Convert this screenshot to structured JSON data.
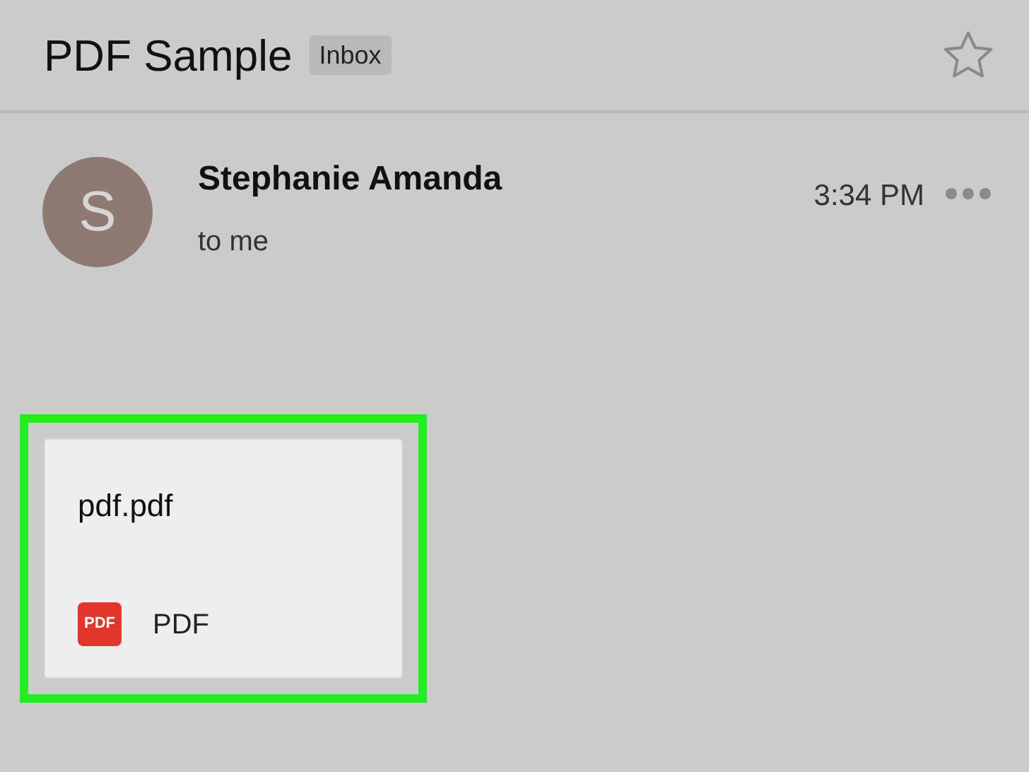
{
  "header": {
    "title": "PDF Sample",
    "label": "Inbox",
    "starred": false
  },
  "message": {
    "avatar_letter": "S",
    "sender": "Stephanie Amanda",
    "recipient": "to me",
    "time": "3:34 PM"
  },
  "attachment": {
    "name": "pdf.pdf",
    "icon_text": "PDF",
    "type_label": "PDF",
    "highlighted": true
  }
}
